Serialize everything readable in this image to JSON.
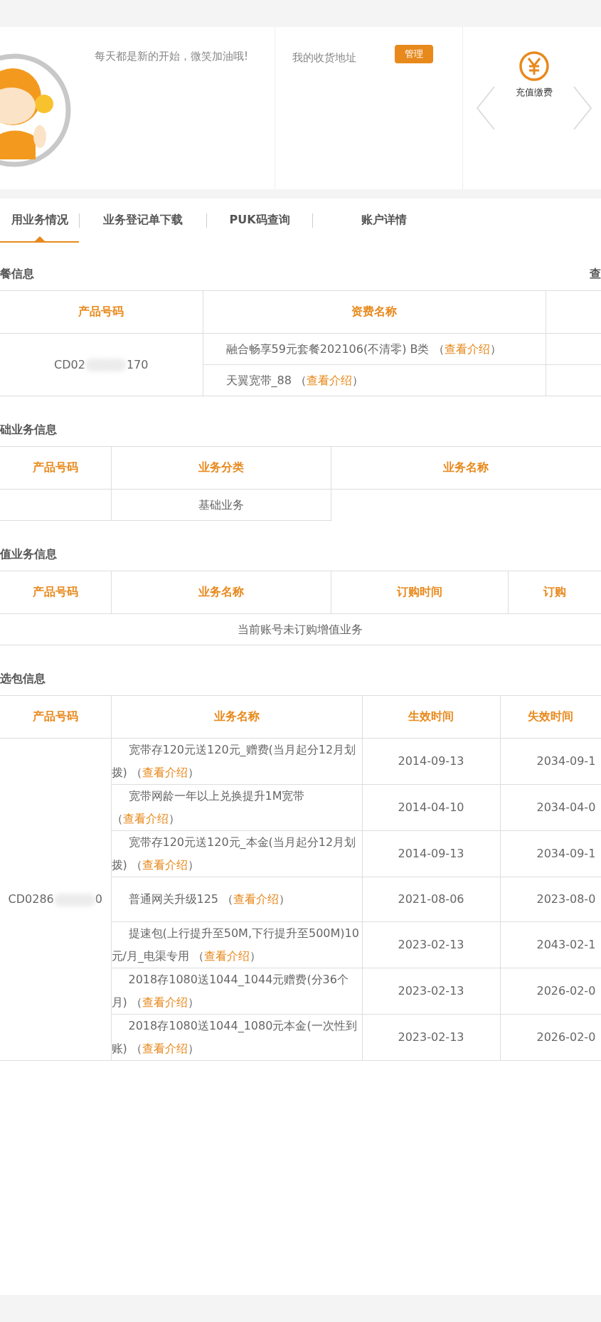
{
  "profile": {
    "slogan": "每天都是新的开始，微笑加油哦!",
    "address_label": "我的收货地址",
    "manage_button": "管理",
    "shortcut_label": "充值缴费"
  },
  "tabs": [
    {
      "label": "用业务情况",
      "selected": true
    },
    {
      "label": "业务登记单下载",
      "selected": false
    },
    {
      "label": "PUK码查询",
      "selected": false
    },
    {
      "label": "账户详情",
      "selected": false
    }
  ],
  "sections": [
    {
      "kind": "package",
      "title": "餐信息",
      "action": "查",
      "columns": [
        "产品号码",
        "资费名称",
        ""
      ],
      "rows": [
        {
          "product": [
            "CD02",
            "170"
          ],
          "items": [
            {
              "name": "融合畅享59元套餐202106(不清零) B类 （",
              "link": "查看介绍",
              "close": "）"
            },
            {
              "name": "天翼宽带_88 （",
              "link": "查看介绍",
              "close": "）"
            }
          ]
        }
      ]
    },
    {
      "kind": "basic",
      "title": "础业务信息",
      "columns": [
        "产品号码",
        "业务分类",
        "业务名称"
      ],
      "rows": [
        {
          "category": "基础业务"
        }
      ]
    },
    {
      "kind": "value_added",
      "title": "值业务信息",
      "columns": [
        "产品号码",
        "业务名称",
        "订购时间",
        "订购"
      ],
      "empty": "当前账号未订购增值业务"
    },
    {
      "kind": "optional",
      "title": "选包信息",
      "columns": [
        "产品号码",
        "业务名称",
        "生效时间",
        "失效时间"
      ],
      "rows": [
        {
          "product": [
            "CD0286",
            "0"
          ],
          "items": [
            {
              "name": "宽带存120元送120元_赠费(当月起分12月划拨) （",
              "link": "查看介绍",
              "close": "）",
              "start": "2014-09-13",
              "end": "2034-09-1"
            },
            {
              "name": "宽带网龄一年以上兑换提升1M宽带（",
              "link": "查看介绍",
              "close": "）",
              "start": "2014-04-10",
              "end": "2034-04-0"
            },
            {
              "name": "宽带存120元送120元_本金(当月起分12月划拨) （",
              "link": "查看介绍",
              "close": "）",
              "start": "2014-09-13",
              "end": "2034-09-1"
            },
            {
              "name": "普通网关升级125 （",
              "link": "查看介绍",
              "close": "）",
              "start": "2021-08-06",
              "end": "2023-08-0"
            },
            {
              "name": "提速包(上行提升至50M,下行提升至500M)10元/月_电渠专用 （",
              "link": "查看介绍",
              "close": "）",
              "start": "2023-02-13",
              "end": "2043-02-1"
            },
            {
              "name": "2018存1080送1044_1044元赠费(分36个月) （",
              "link": "查看介绍",
              "close": "）",
              "start": "2023-02-13",
              "end": "2026-02-0"
            },
            {
              "name": "2018存1080送1044_1080元本金(一次性到账) （",
              "link": "查看介绍",
              "close": "）",
              "start": "2023-02-13",
              "end": "2026-02-0"
            }
          ]
        }
      ]
    }
  ]
}
